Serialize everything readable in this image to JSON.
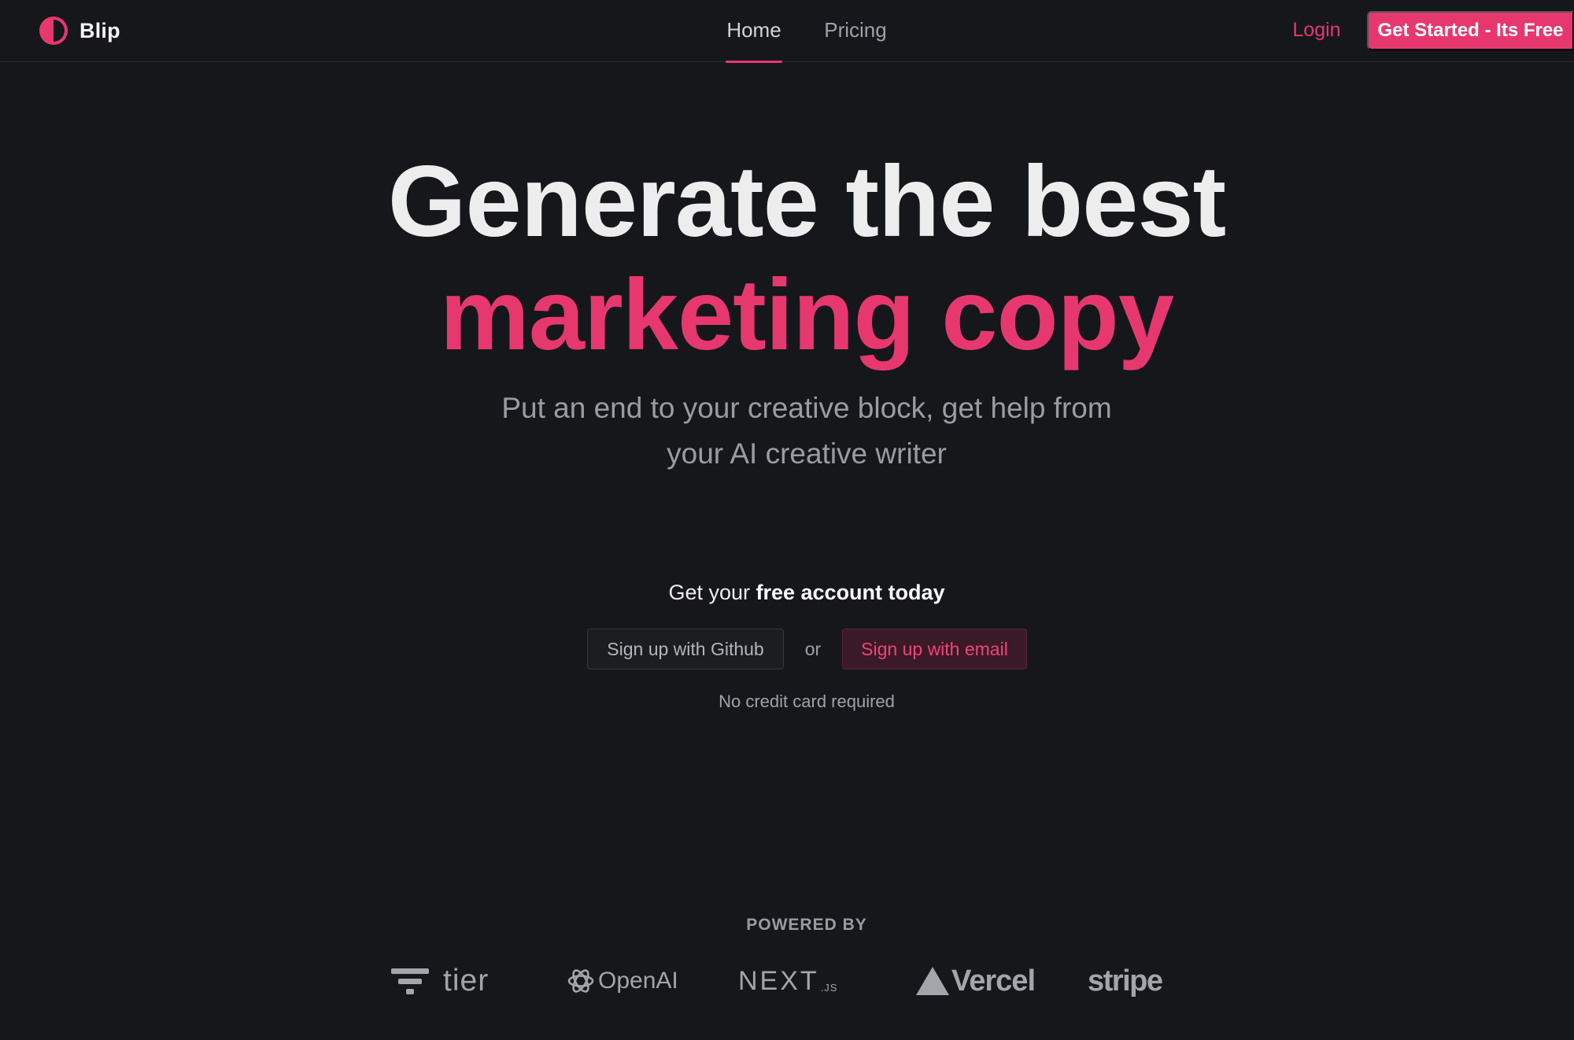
{
  "brand": {
    "name": "Blip",
    "logo_icon": "half-circle-icon",
    "accent_color": "#e6386f"
  },
  "nav": {
    "tabs": [
      {
        "label": "Home",
        "active": true
      },
      {
        "label": "Pricing",
        "active": false
      }
    ]
  },
  "header": {
    "login_label": "Login",
    "cta_label": "Get Started - Its Free"
  },
  "hero": {
    "headline_line1": "Generate the best",
    "headline_line2": "marketing copy",
    "subtitle_line1": "Put an end to your creative block, get help from",
    "subtitle_line2": "your AI creative writer"
  },
  "signup": {
    "heading_prefix": "Get your ",
    "heading_bold": "free account today",
    "github_label": "Sign up with Github",
    "or_label": "or",
    "email_label": "Sign up with email",
    "note": "No credit card required"
  },
  "powered_by": {
    "label": "POWERED BY",
    "logos": [
      {
        "name": "tier",
        "icon": "tier-logo-icon"
      },
      {
        "name": "OpenAI",
        "icon": "openai-logo-icon"
      },
      {
        "name": "NEXT",
        "suffix": ".JS"
      },
      {
        "name": "Vercel",
        "icon": "vercel-triangle-icon"
      },
      {
        "name": "stripe"
      }
    ]
  }
}
